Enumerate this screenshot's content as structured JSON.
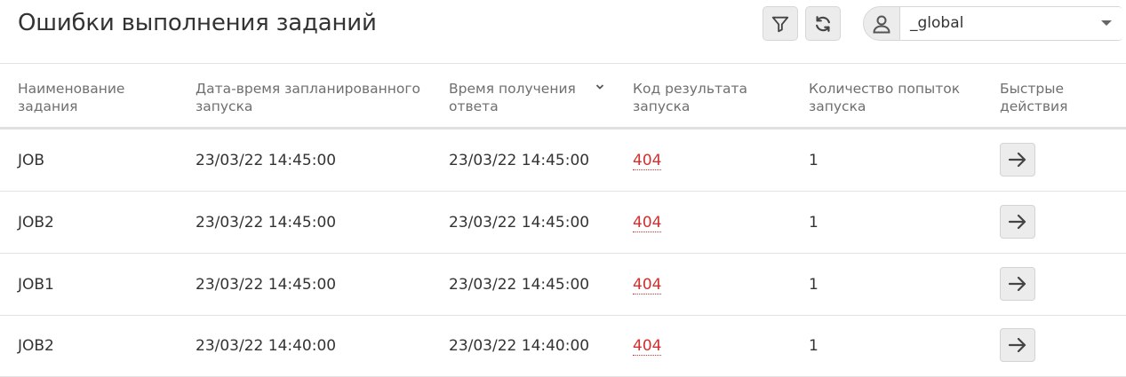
{
  "header": {
    "title": "Ошибки выполнения заданий",
    "filter_icon": "filter-icon",
    "refresh_icon": "refresh-icon",
    "user_icon": "user-icon",
    "environment": "_global"
  },
  "table": {
    "columns": [
      "Наименование\nзадания",
      "Дата-время запланированного\nзапуска",
      "Время получения\nответа",
      "Код результата\nзапуска",
      "Количество попыток\nзапуска",
      "Быстрые\nдействия"
    ],
    "sorted_column": "Время получения ответа",
    "rows": [
      {
        "name": "JOB",
        "scheduled": "23/03/22 14:45:00",
        "received": "23/03/22 14:45:00",
        "code": "404",
        "attempts": "1",
        "action_icon": "arrow-right-icon"
      },
      {
        "name": "JOB2",
        "scheduled": "23/03/22 14:45:00",
        "received": "23/03/22 14:45:00",
        "code": "404",
        "attempts": "1",
        "action_icon": "arrow-right-icon"
      },
      {
        "name": "JOB1",
        "scheduled": "23/03/22 14:45:00",
        "received": "23/03/22 14:45:00",
        "code": "404",
        "attempts": "1",
        "action_icon": "arrow-right-icon"
      },
      {
        "name": "JOB2",
        "scheduled": "23/03/22 14:40:00",
        "received": "23/03/22 14:40:00",
        "code": "404",
        "attempts": "1",
        "action_icon": "arrow-right-icon"
      }
    ]
  },
  "colors": {
    "error_code": "#d32f2f",
    "header_text": "#6f6f6f",
    "button_bg": "#ececec"
  }
}
